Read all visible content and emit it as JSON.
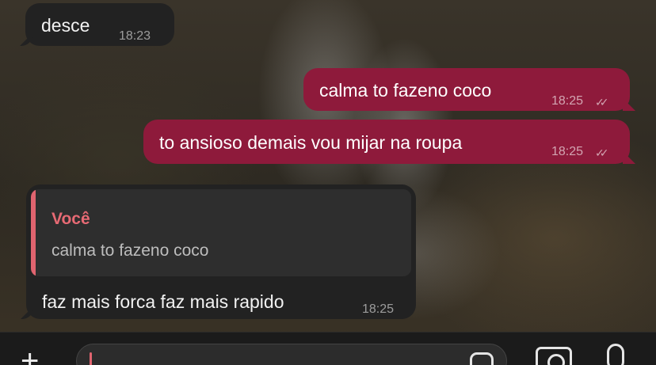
{
  "messages": [
    {
      "direction": "in",
      "text": "desce",
      "time": "18:23"
    },
    {
      "direction": "out",
      "text": "calma to fazeno coco",
      "time": "18:25",
      "status": "read"
    },
    {
      "direction": "out",
      "text": "to ansioso demais vou mijar na roupa",
      "time": "18:25",
      "status": "read"
    },
    {
      "direction": "in",
      "reply": {
        "author": "Você",
        "text": "calma to fazeno coco"
      },
      "text": "faz mais forca faz mais rapido",
      "time": "18:25"
    }
  ],
  "checkmark_glyph": "✓✓",
  "input_bar": {
    "plus_glyph": "+",
    "placeholder": ""
  },
  "colors": {
    "outgoing_bubble": "#8e1a3b",
    "incoming_bubble": "#222222",
    "reply_accent": "#e0646f"
  },
  "icons": [
    "plus-icon",
    "sticker-icon",
    "camera-icon",
    "microphone-icon",
    "double-check-icon"
  ]
}
